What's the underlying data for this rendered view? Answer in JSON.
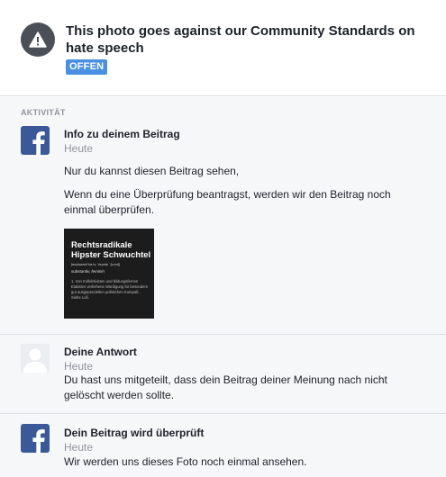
{
  "header": {
    "title": "This photo goes against our Community Standards on hate speech",
    "status_badge": "OFFEN",
    "icon": "warning-icon"
  },
  "activity": {
    "section_label": "AKTIVITÄT",
    "items": [
      {
        "icon": "facebook-icon",
        "title": "Info zu deinem Beitrag",
        "time": "Heute",
        "text": [
          "Nur du kannst diesen Beitrag sehen,",
          "Wenn du eine Überprüfung beantragst, werden wir den Beitrag noch einmal überprüfen."
        ],
        "image": {
          "title": "Rechtsradikale Hipster Schwuchtel",
          "pronunciation": "[ʁɛçtsʁadiˈkaːlə ˈhɪpstɐ ˈʃvʊxtl̩]",
          "word_type": "substantiv, feminin",
          "definition": "1. Von Kollektivisten und bildungsfernen Etatisten verliehene Würdigung für besonders gut ausgependelten politischen Kompaß . Siehe Lufi."
        }
      },
      {
        "icon": "avatar-icon",
        "title": "Deine Antwort",
        "time": "Heute",
        "text": [
          "Du hast uns mitgeteilt, dass dein Beitrag deiner Meinung nach nicht gelöscht werden sollte."
        ]
      },
      {
        "icon": "facebook-icon",
        "title": "Dein Beitrag wird überprüft",
        "time": "Heute",
        "text": [
          "Wir werden uns dieses Foto noch einmal ansehen."
        ]
      }
    ]
  },
  "colors": {
    "facebook_blue": "#3b5998",
    "badge_blue": "#4a90e2",
    "muted_text": "#90949c",
    "background": "#f6f7f9"
  }
}
